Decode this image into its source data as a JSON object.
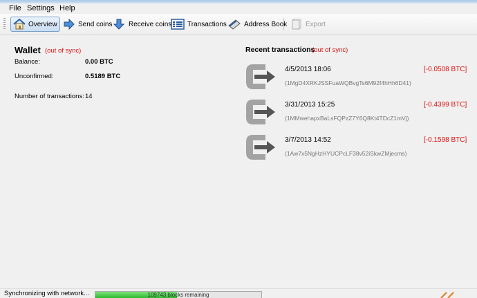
{
  "menu": {
    "file": "File",
    "settings": "Settings",
    "help": "Help"
  },
  "toolbar": {
    "overview": "Overview",
    "send": "Send coins",
    "receive": "Receive coins",
    "transactions": "Transactions",
    "addressbook": "Address Book",
    "export": "Export"
  },
  "wallet": {
    "title": "Wallet",
    "sync": "(out of sync)",
    "balance_label": "Balance:",
    "balance_value": "0.00 BTC",
    "unconfirmed_label": "Unconfirmed:",
    "unconfirmed_value": "0.5189 BTC",
    "ntx_label": "Number of transactions:",
    "ntx_value": "14"
  },
  "recent": {
    "title": "Recent transactions",
    "sync": "(out of sync)",
    "items": [
      {
        "date": "4/5/2013 18:06",
        "amount": "[-0.0508 BTC]",
        "address": "(1MgD4XRKJSSFuaWQBvgTs6M92f4hHh6D41)"
      },
      {
        "date": "3/31/2013 15:25",
        "amount": "[-0.4399 BTC]",
        "address": "(1MMwehapxBaLsFQPzZ7Y6Q8Kt4TDcZ1mVj)"
      },
      {
        "date": "3/7/2013 14:52",
        "amount": "[-0.1598 BTC]",
        "address": "(1Aw7x5NgHzHYUCPcLF38v52iSkwZMjecms)"
      }
    ]
  },
  "status": {
    "text": "Synchronizing with network...",
    "progress_fraction": 0.49,
    "progress_text": "109743 blocks remaining"
  },
  "icons": {
    "overview": "home-icon",
    "send": "send-arrow-icon",
    "receive": "receive-arrow-icon",
    "transactions": "list-icon",
    "addressbook": "address-book-icon",
    "export": "export-icon",
    "tx": "outgoing-transaction-icon"
  },
  "colors": {
    "out_of_sync": "#dd1111",
    "progress": "#25b425",
    "active_tab": "#c9ddf2"
  }
}
